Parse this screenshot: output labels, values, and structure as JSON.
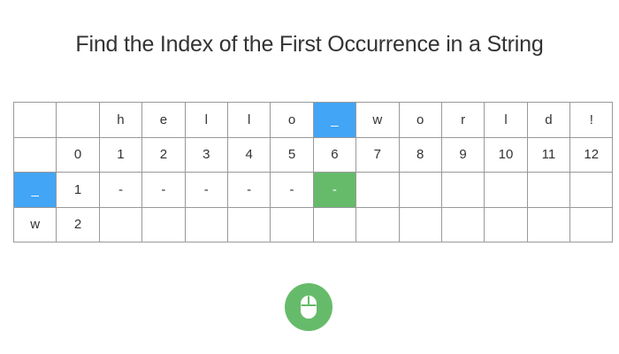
{
  "title": "Find the Index of the First Occurrence in a String",
  "table": {
    "header_chars": [
      "",
      "",
      "h",
      "e",
      "l",
      "l",
      "o",
      "_",
      "w",
      "o",
      "r",
      "l",
      "d",
      "!"
    ],
    "index_row": [
      "",
      "0",
      "1",
      "2",
      "3",
      "4",
      "5",
      "6",
      "7",
      "8",
      "9",
      "10",
      "11",
      "12"
    ],
    "needle_rows": [
      {
        "cells": [
          "_",
          "1",
          "-",
          "-",
          "-",
          "-",
          "-",
          "-",
          "",
          "",
          "",
          "",
          "",
          ""
        ]
      },
      {
        "cells": [
          "w",
          "2",
          "",
          "",
          "",
          "",
          "",
          "",
          "",
          "",
          "",
          "",
          "",
          ""
        ]
      }
    ],
    "highlights": {
      "blue": [
        [
          0,
          7
        ],
        [
          2,
          0
        ]
      ],
      "green": [
        [
          2,
          7
        ]
      ]
    }
  },
  "colors": {
    "blue": "#42a5f5",
    "green": "#66bb6a",
    "border": "#999999"
  },
  "controls": {
    "mouse_button_icon": "mouse-icon"
  }
}
